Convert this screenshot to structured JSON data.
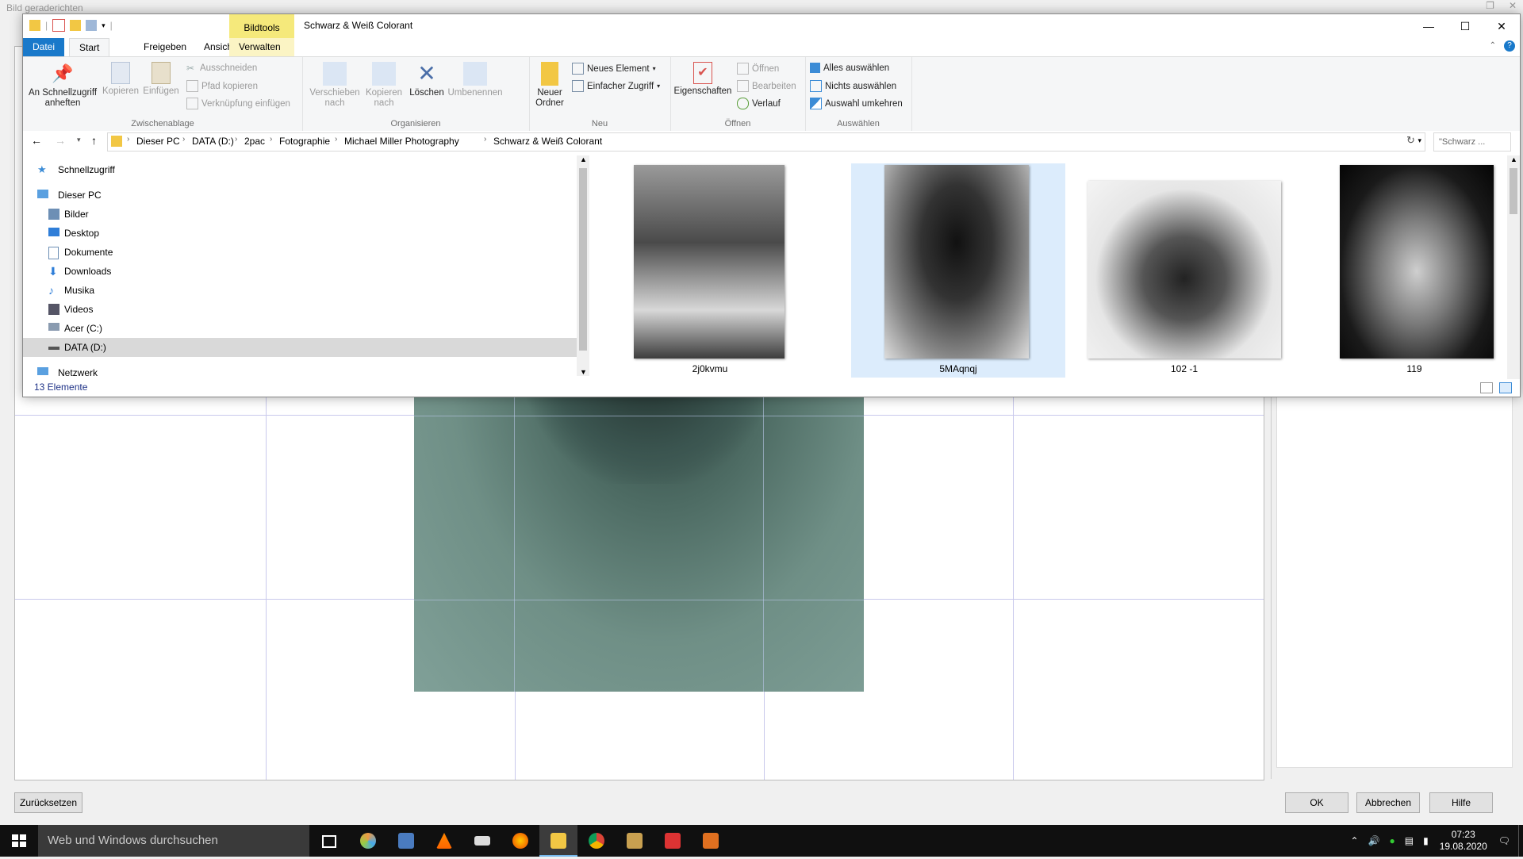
{
  "background_app": {
    "title": "Bild geraderichten",
    "buttons": {
      "reset": "Zurücksetzen",
      "ok": "OK",
      "cancel": "Abbrechen",
      "help": "Hilfe"
    }
  },
  "explorer": {
    "context_tab": "Bildtools",
    "window_title": "Schwarz & Weiß Colorant",
    "tabs": {
      "datei": "Datei",
      "start": "Start",
      "freigeben": "Freigeben",
      "ansicht": "Ansicht",
      "verwalten": "Verwalten"
    },
    "ribbon": {
      "clipboard": {
        "label": "Zwischenablage",
        "pin": "An Schnellzugriff anheften",
        "copy": "Kopieren",
        "paste": "Einfügen",
        "cut": "Ausschneiden",
        "copy_path": "Pfad kopieren",
        "paste_shortcut": "Verknüpfung einfügen"
      },
      "organize": {
        "label": "Organisieren",
        "move_to": "Verschieben nach",
        "copy_to": "Kopieren nach",
        "delete": "Löschen",
        "rename": "Umbenennen"
      },
      "new": {
        "label": "Neu",
        "new_folder": "Neuer Ordner",
        "new_item": "Neues Element",
        "easy_access": "Einfacher Zugriff"
      },
      "open": {
        "label": "Öffnen",
        "properties": "Eigenschaften",
        "open": "Öffnen",
        "edit": "Bearbeiten",
        "history": "Verlauf"
      },
      "select": {
        "label": "Auswählen",
        "select_all": "Alles auswählen",
        "select_none": "Nichts auswählen",
        "invert": "Auswahl umkehren"
      }
    },
    "breadcrumb": [
      "Dieser PC",
      "DATA (D:)",
      "2pac",
      "Fotographie",
      "Michael Miller Photography",
      "Schwarz & Weiß Colorant"
    ],
    "search_placeholder": "\"Schwarz ...",
    "nav": {
      "quick_access": "Schnellzugriff",
      "this_pc": "Dieser PC",
      "items": [
        "Bilder",
        "Desktop",
        "Dokumente",
        "Downloads",
        "Musika",
        "Videos",
        "Acer (C:)",
        "DATA (D:)"
      ],
      "network": "Netzwerk"
    },
    "files": [
      {
        "name": "2j0kvmu"
      },
      {
        "name": "5MAqnqj"
      },
      {
        "name": "102 -1"
      },
      {
        "name": "119"
      }
    ],
    "status": "13 Elemente"
  },
  "taskbar": {
    "search_placeholder": "Web und Windows durchsuchen",
    "time": "07:23",
    "date": "19.08.2020"
  }
}
